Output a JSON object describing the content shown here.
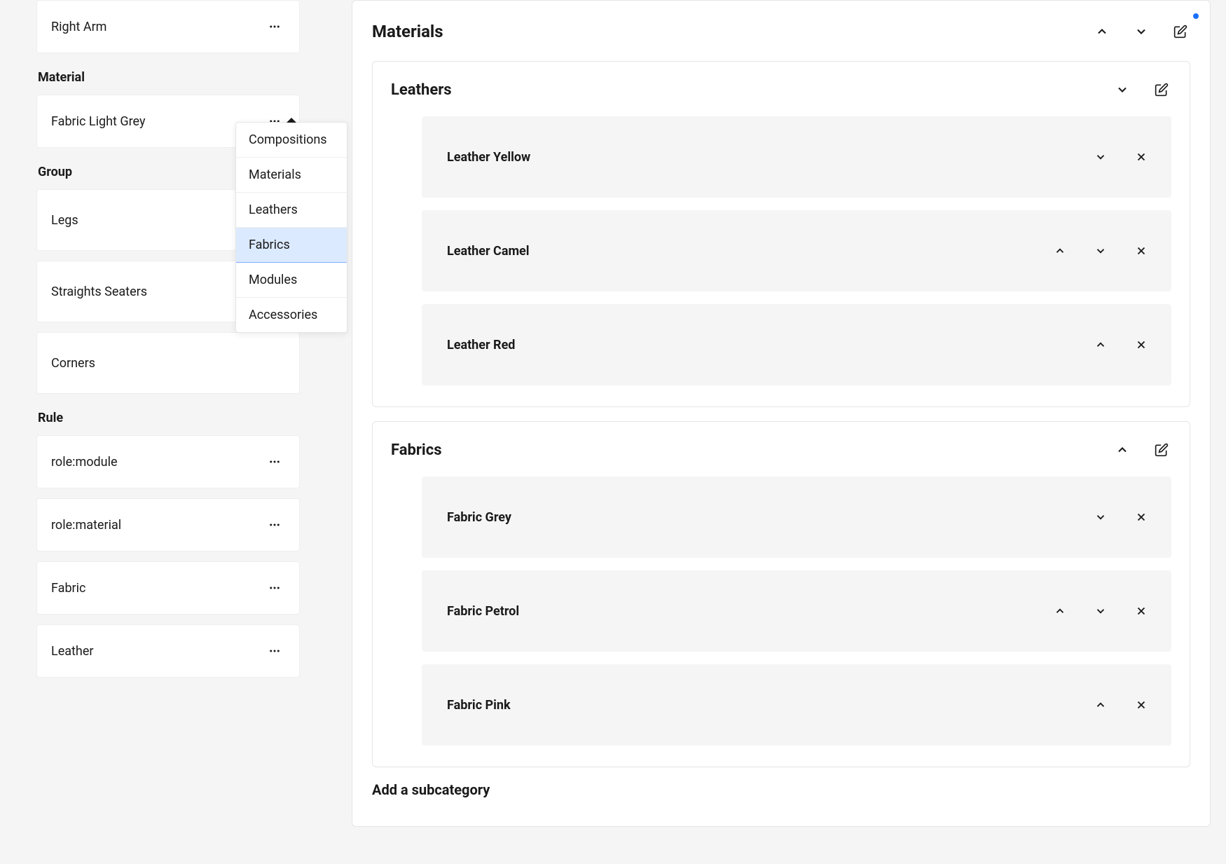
{
  "sidebar": {
    "right_arm": {
      "label": "Right Arm"
    },
    "material_section": {
      "title": "Material"
    },
    "material_item": {
      "label": "Fabric Light Grey"
    },
    "group_section": {
      "title": "Group"
    },
    "groups": [
      {
        "label": "Legs"
      },
      {
        "label": "Straights Seaters"
      },
      {
        "label": "Corners"
      }
    ],
    "rule_section": {
      "title": "Rule"
    },
    "rules": [
      {
        "label": "role:module"
      },
      {
        "label": "role:material"
      },
      {
        "label": "Fabric"
      },
      {
        "label": "Leather"
      }
    ]
  },
  "dropdown": {
    "items": [
      {
        "label": "Compositions",
        "selected": false
      },
      {
        "label": "Materials",
        "selected": false
      },
      {
        "label": "Leathers",
        "selected": false
      },
      {
        "label": "Fabrics",
        "selected": true
      },
      {
        "label": "Modules",
        "selected": false
      },
      {
        "label": "Accessories",
        "selected": false
      }
    ]
  },
  "main": {
    "title": "Materials",
    "categories": [
      {
        "title": "Leathers",
        "expand_up": false,
        "items": [
          {
            "label": "Leather Yellow",
            "up": false,
            "down": true
          },
          {
            "label": "Leather Camel",
            "up": true,
            "down": true
          },
          {
            "label": "Leather Red",
            "up": true,
            "down": false
          }
        ]
      },
      {
        "title": "Fabrics",
        "expand_up": true,
        "items": [
          {
            "label": "Fabric Grey",
            "up": false,
            "down": true
          },
          {
            "label": "Fabric Petrol",
            "up": true,
            "down": true
          },
          {
            "label": "Fabric Pink",
            "up": true,
            "down": false
          }
        ]
      }
    ],
    "add_subcategory": "Add a subcategory"
  }
}
